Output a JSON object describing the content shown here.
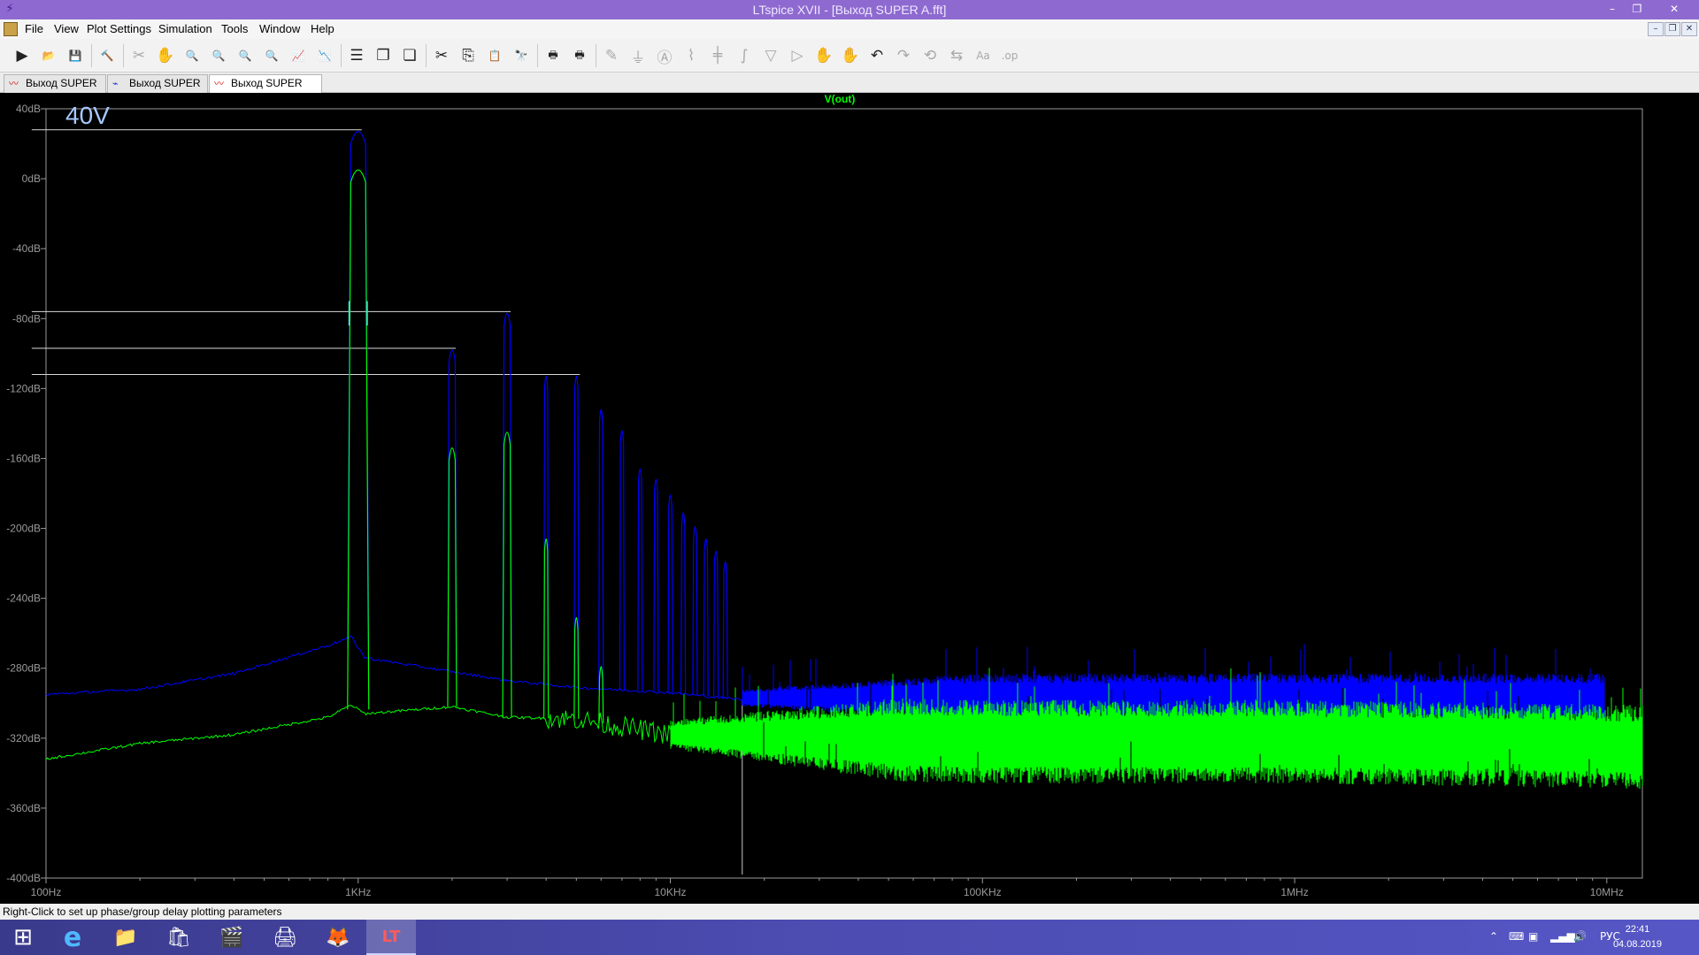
{
  "window": {
    "title": "LTspice XVII - [Выход SUPER A.fft]",
    "minimize_glyph": "–",
    "restore_glyph": "❐",
    "close_glyph": "✕"
  },
  "menu": {
    "items": [
      "File",
      "View",
      "Plot Settings",
      "Simulation",
      "Tools",
      "Window",
      "Help"
    ]
  },
  "toolbar": {
    "buttons": [
      {
        "name": "run-icon",
        "glyph": "▶",
        "enabled": true
      },
      {
        "name": "open-icon",
        "glyph": "📂",
        "enabled": true
      },
      {
        "name": "save-icon",
        "glyph": "💾",
        "enabled": true
      },
      {
        "name": "control-panel-icon",
        "glyph": "🔨",
        "enabled": true
      },
      {
        "name": "halt-icon",
        "glyph": "✂",
        "enabled": false
      },
      {
        "name": "pan-icon",
        "glyph": "✋",
        "enabled": false
      },
      {
        "name": "zoom-in-icon",
        "glyph": "🔍",
        "enabled": true
      },
      {
        "name": "zoom-area-icon",
        "glyph": "🔍",
        "enabled": true
      },
      {
        "name": "zoom-out-icon",
        "glyph": "🔍",
        "enabled": true
      },
      {
        "name": "zoom-fit-icon",
        "glyph": "🔍",
        "enabled": true
      },
      {
        "name": "autorange-icon",
        "glyph": "📈",
        "enabled": true
      },
      {
        "name": "autoscale-icon",
        "glyph": "📉",
        "enabled": true
      },
      {
        "name": "tile-horizontal-icon",
        "glyph": "☰",
        "enabled": true
      },
      {
        "name": "cascade-icon",
        "glyph": "❐",
        "enabled": true
      },
      {
        "name": "tile-vertical-icon",
        "glyph": "❏",
        "enabled": true
      },
      {
        "name": "cut-icon",
        "glyph": "✂",
        "enabled": true
      },
      {
        "name": "copy-icon",
        "glyph": "⎘",
        "enabled": true
      },
      {
        "name": "paste-icon",
        "glyph": "📋",
        "enabled": true
      },
      {
        "name": "find-icon",
        "glyph": "🔭",
        "enabled": true
      },
      {
        "name": "print-icon",
        "glyph": "🖶",
        "enabled": true
      },
      {
        "name": "print-preview-icon",
        "glyph": "🖶",
        "enabled": true
      },
      {
        "name": "draw-wire-icon",
        "glyph": "✎",
        "enabled": false
      },
      {
        "name": "ground-icon",
        "glyph": "⏚",
        "enabled": false
      },
      {
        "name": "label-net-icon",
        "glyph": "Ⓐ",
        "enabled": false
      },
      {
        "name": "resistor-icon",
        "glyph": "⌇",
        "enabled": false
      },
      {
        "name": "capacitor-icon",
        "glyph": "╪",
        "enabled": false
      },
      {
        "name": "inductor-icon",
        "glyph": "∫",
        "enabled": false
      },
      {
        "name": "diode-icon",
        "glyph": "▽",
        "enabled": false
      },
      {
        "name": "component-icon",
        "glyph": "▷",
        "enabled": false
      },
      {
        "name": "move-icon",
        "glyph": "✋",
        "enabled": false
      },
      {
        "name": "drag-icon",
        "glyph": "✋",
        "enabled": false
      },
      {
        "name": "undo-icon",
        "glyph": "↶",
        "enabled": true
      },
      {
        "name": "redo-icon",
        "glyph": "↷",
        "enabled": false
      },
      {
        "name": "rotate-icon",
        "glyph": "⟲",
        "enabled": false
      },
      {
        "name": "mirror-icon",
        "glyph": "⇆",
        "enabled": false
      },
      {
        "name": "text-icon",
        "glyph": "Aa",
        "enabled": false
      },
      {
        "name": "spice-directive-icon",
        "glyph": ".op",
        "enabled": false
      }
    ]
  },
  "tabs": [
    {
      "label": "Выход SUPER A",
      "icon": "waveform-icon",
      "active": false
    },
    {
      "label": "Выход SUPER A",
      "icon": "schematic-icon",
      "active": false
    },
    {
      "label": "Выход SUPER A.fft",
      "icon": "waveform-icon",
      "active": true
    }
  ],
  "plot": {
    "trace_name": "V(out)",
    "annotation": "40V",
    "background": "#000000",
    "colors": {
      "trace_blue": "#0000ff",
      "trace_green": "#00ff00",
      "axis": "#9a9a9a",
      "trace_label": "#00ff00",
      "annotation": "#a8c8ff",
      "cursor": "#c8c8c8"
    }
  },
  "chart_data": {
    "type": "line",
    "title": "V(out)",
    "xlabel": "",
    "ylabel": "",
    "x_scale": "log",
    "xlim": [
      100,
      13000000
    ],
    "ylim": [
      -400,
      40
    ],
    "x_ticks": [
      {
        "value": 100,
        "label": "100Hz"
      },
      {
        "value": 1000,
        "label": "1KHz"
      },
      {
        "value": 10000,
        "label": "10KHz"
      },
      {
        "value": 100000,
        "label": "100KHz"
      },
      {
        "value": 1000000,
        "label": "1MHz"
      },
      {
        "value": 10000000,
        "label": "10MHz"
      }
    ],
    "y_ticks": [
      {
        "value": 40,
        "label": "40dB"
      },
      {
        "value": 0,
        "label": "0dB"
      },
      {
        "value": -40,
        "label": "-40dB"
      },
      {
        "value": -80,
        "label": "-80dB"
      },
      {
        "value": -120,
        "label": "-120dB"
      },
      {
        "value": -160,
        "label": "-160dB"
      },
      {
        "value": -200,
        "label": "-200dB"
      },
      {
        "value": -240,
        "label": "-240dB"
      },
      {
        "value": -280,
        "label": "-280dB"
      },
      {
        "value": -320,
        "label": "-320dB"
      },
      {
        "value": -360,
        "label": "-360dB"
      },
      {
        "value": -400,
        "label": "-400dB"
      }
    ],
    "grid": false,
    "series": [
      {
        "color": "#0000ff",
        "floor": [
          [
            100,
            -295
          ],
          [
            200,
            -292
          ],
          [
            400,
            -283
          ],
          [
            800,
            -267
          ],
          [
            950,
            -262
          ],
          [
            1050,
            -274
          ],
          [
            2000,
            -282
          ],
          [
            3000,
            -287
          ],
          [
            5000,
            -291
          ],
          [
            10000,
            -294
          ],
          [
            17000,
            -298
          ],
          [
            30000,
            -298
          ],
          [
            100000,
            -298
          ],
          [
            1000000,
            -298
          ],
          [
            9800000,
            -298
          ]
        ],
        "noise_band": [
          [
            17000,
            -297
          ],
          [
            100000,
            -297
          ],
          [
            1000000,
            -297
          ],
          [
            9800000,
            -297
          ]
        ],
        "noise_halfwidth_db": 14,
        "peaks": [
          {
            "x": 1000,
            "y": 28
          },
          {
            "x": 2000,
            "y": -97
          },
          {
            "x": 3000,
            "y": -76
          },
          {
            "x": 4000,
            "y": -112
          },
          {
            "x": 5000,
            "y": -112
          },
          {
            "x": 6000,
            "y": -131
          },
          {
            "x": 7000,
            "y": -143
          },
          {
            "x": 8000,
            "y": -165
          },
          {
            "x": 9000,
            "y": -171
          },
          {
            "x": 10000,
            "y": -180
          },
          {
            "x": 11000,
            "y": -190
          },
          {
            "x": 12000,
            "y": -198
          },
          {
            "x": 13000,
            "y": -205
          },
          {
            "x": 14000,
            "y": -212
          },
          {
            "x": 15000,
            "y": -218
          }
        ]
      },
      {
        "color": "#00ff00",
        "floor": [
          [
            100,
            -332
          ],
          [
            200,
            -323
          ],
          [
            400,
            -318
          ],
          [
            800,
            -308
          ],
          [
            950,
            -301
          ],
          [
            1050,
            -306
          ],
          [
            2000,
            -302
          ],
          [
            3000,
            -308
          ],
          [
            5000,
            -309
          ],
          [
            10000,
            -318
          ],
          [
            17000,
            -322
          ],
          [
            100000,
            -322
          ],
          [
            1000000,
            -322
          ],
          [
            10000000,
            -322
          ],
          [
            13000000,
            -322
          ]
        ],
        "noise_band": [
          [
            10000,
            -318
          ],
          [
            100000,
            -322
          ],
          [
            1000000,
            -322
          ],
          [
            13000000,
            -325
          ]
        ],
        "noise_halfwidth_db": 24,
        "peaks": [
          {
            "x": 1000,
            "y": 6
          },
          {
            "x": 2000,
            "y": -153
          },
          {
            "x": 3000,
            "y": -144
          },
          {
            "x": 4000,
            "y": -205
          },
          {
            "x": 5000,
            "y": -250
          },
          {
            "x": 6000,
            "y": -278
          }
        ]
      }
    ],
    "markers": [
      {
        "y": 28,
        "x_from": 90,
        "x_to": 1000
      },
      {
        "y": -76,
        "x_from": 90,
        "x_to": 3000
      },
      {
        "y": -97,
        "x_from": 90,
        "x_to": 2000
      },
      {
        "y": -112,
        "x_from": 90,
        "x_to": 5000
      }
    ],
    "cursor_x": 17000
  },
  "status": {
    "text": "Right-Click to set up phase/group delay plotting parameters"
  },
  "taskbar": {
    "start_glyph": "⊞",
    "apps": [
      {
        "name": "ie-icon",
        "glyph": "e",
        "active": false
      },
      {
        "name": "file-explorer-icon",
        "glyph": "📁",
        "active": false
      },
      {
        "name": "store-icon",
        "glyph": "🛍",
        "active": false
      },
      {
        "name": "media-icon",
        "glyph": "🎬",
        "active": false
      },
      {
        "name": "scanner-icon",
        "glyph": "🖨",
        "active": false
      },
      {
        "name": "firefox-icon",
        "glyph": "🦊",
        "active": false
      },
      {
        "name": "ltspice-icon",
        "glyph": "LT",
        "active": true
      }
    ],
    "tray": {
      "chevron": "⌃",
      "lang": "РУС",
      "time": "22:41",
      "date": "04.08.2019"
    }
  }
}
